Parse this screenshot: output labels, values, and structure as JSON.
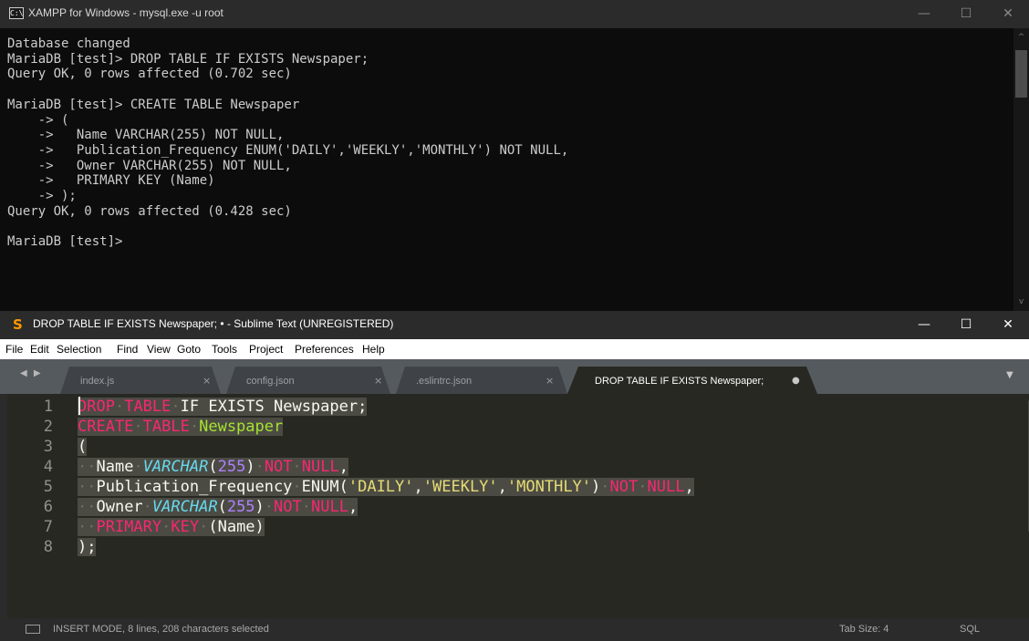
{
  "console": {
    "title": "XAMPP for Windows - mysql.exe  -u root",
    "icon": "console-icon",
    "lines": [
      "Database changed",
      "MariaDB [test]> DROP TABLE IF EXISTS Newspaper;",
      "Query OK, 0 rows affected (0.702 sec)",
      "",
      "MariaDB [test]> CREATE TABLE Newspaper",
      "    -> (",
      "    ->   Name VARCHAR(255) NOT NULL,",
      "    ->   Publication_Frequency ENUM('DAILY','WEEKLY','MONTHLY') NOT NULL,",
      "    ->   Owner VARCHAR(255) NOT NULL,",
      "    ->   PRIMARY KEY (Name)",
      "    -> );",
      "Query OK, 0 rows affected (0.428 sec)",
      "",
      "MariaDB [test]>"
    ]
  },
  "window_controls": {
    "minimize": "—",
    "maximize": "☐",
    "close": "✕"
  },
  "sublime": {
    "title": "DROP TABLE IF EXISTS Newspaper; • - Sublime Text (UNREGISTERED)",
    "logo": "sublime-logo-icon",
    "menu": [
      "File",
      "Edit",
      "Selection",
      "Find",
      "View",
      "Goto",
      "Tools",
      "Project",
      "Preferences",
      "Help"
    ],
    "tab_nav": "◀ ▶",
    "tabs": [
      {
        "label": "index.js",
        "close": "×"
      },
      {
        "label": "config.json",
        "close": "×"
      },
      {
        "label": ".eslintrc.json",
        "close": "×"
      },
      {
        "label": "DROP TABLE IF EXISTS Newspaper;",
        "close": "●"
      }
    ],
    "tab_overflow": "▼",
    "line_numbers": [
      "1",
      "2",
      "3",
      "4",
      "5",
      "6",
      "7",
      "8"
    ],
    "status": {
      "text": "INSERT MODE, 8 lines, 208 characters selected",
      "tab_size": "Tab Size: 4",
      "syntax": "SQL"
    },
    "colors": {
      "editor_bg": "#272822",
      "selection": "#4b4b43",
      "keyword": "#f92672",
      "type": "#66d9ef",
      "number": "#ae81ff",
      "string": "#e6db74",
      "name": "#a6e22e"
    }
  },
  "code": {
    "l1": {
      "drop": "DROP",
      "table": "TABLE",
      "if_exists": "IF EXISTS Newspaper;"
    },
    "l2": {
      "create": "CREATE",
      "table": "TABLE",
      "name": "Newspaper"
    },
    "l3": {
      "paren": "("
    },
    "l4": {
      "col": "Name",
      "type": "VARCHAR",
      "open": "(",
      "num": "255",
      "close": ")",
      "not": "NOT",
      "null": "NULL",
      "comma": ","
    },
    "l5": {
      "col": "Publication_Frequency",
      "enum": "ENUM(",
      "s1": "'DAILY'",
      "s2": "'WEEKLY'",
      "s3": "'MONTHLY'",
      "comma": ",",
      "close": ")",
      "not": "NOT",
      "null": "NULL",
      "end": ","
    },
    "l6": {
      "col": "Owner",
      "type": "VARCHAR",
      "open": "(",
      "num": "255",
      "close": ")",
      "not": "NOT",
      "null": "NULL",
      "comma": ","
    },
    "l7": {
      "primary": "PRIMARY",
      "key": "KEY",
      "name": "(Name)"
    },
    "l8": {
      "end": ");"
    },
    "ws": {
      "dot": "·",
      "dots": "··"
    }
  }
}
